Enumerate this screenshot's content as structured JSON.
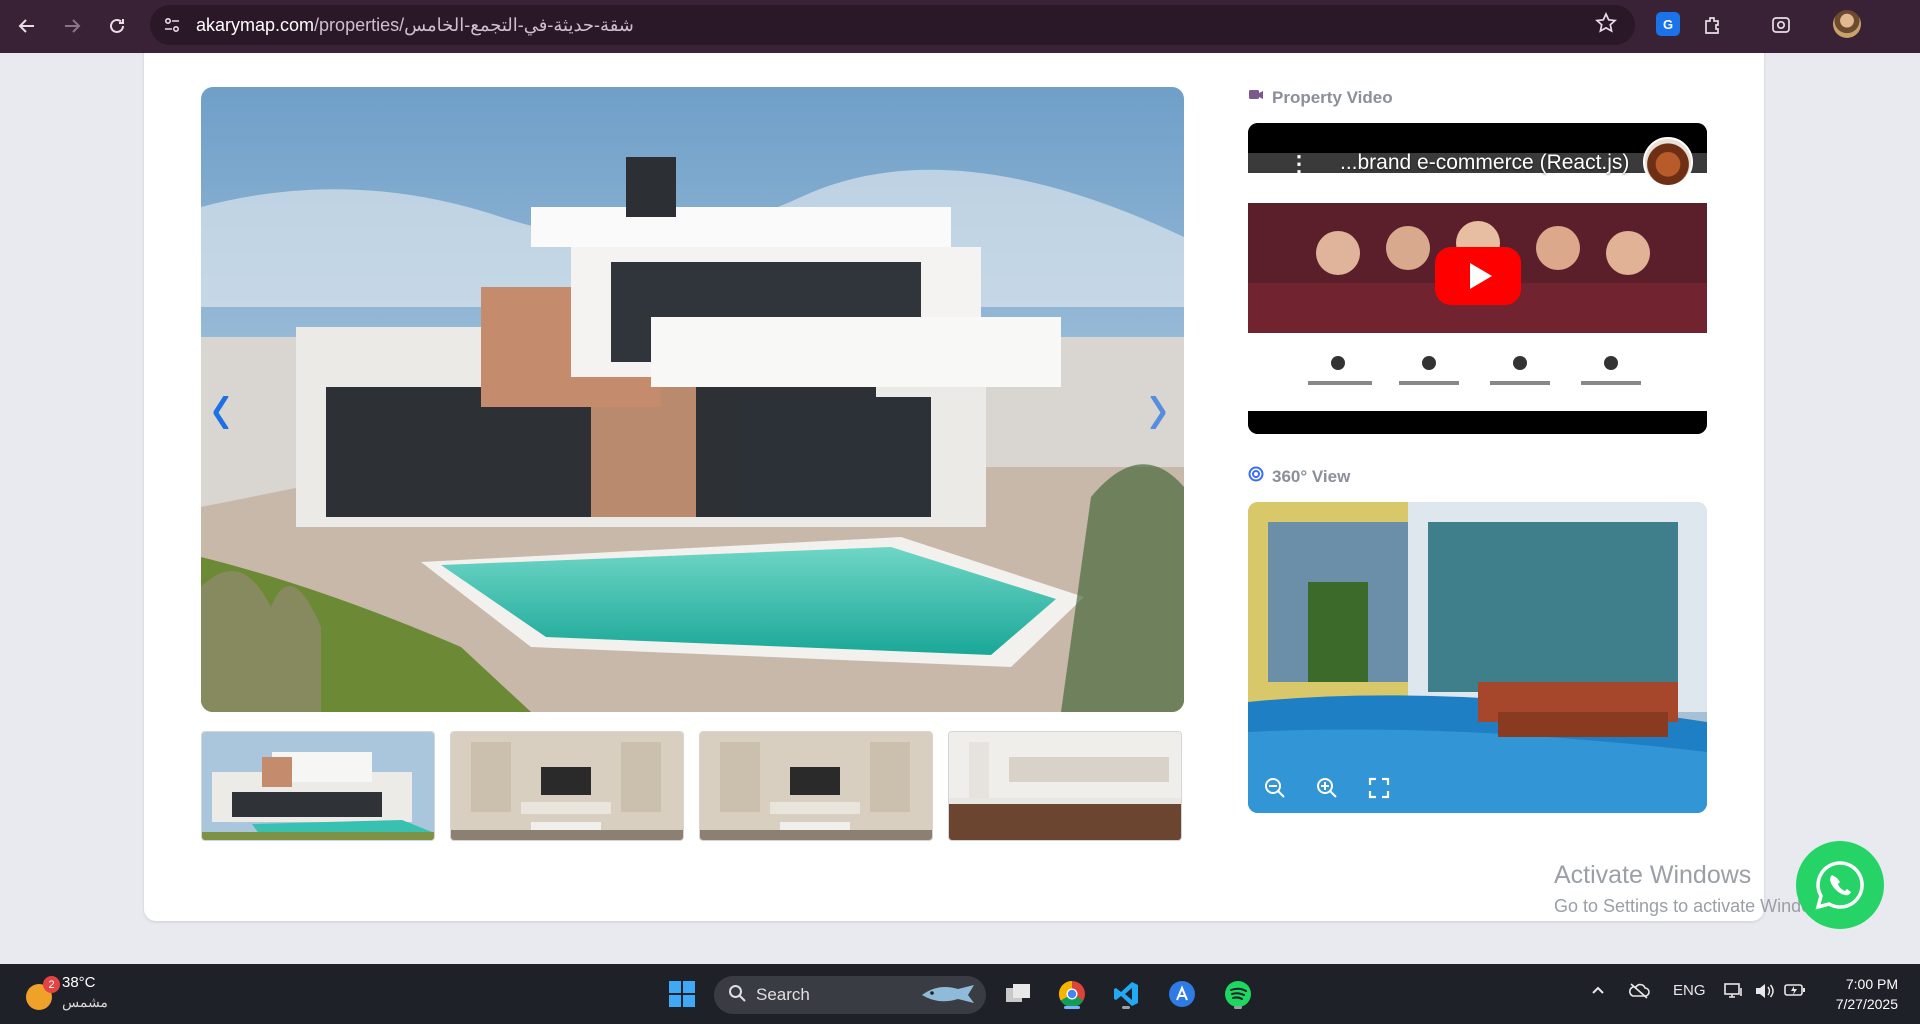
{
  "browser": {
    "url_host": "akarymap.com",
    "url_path": "/properties/شقة-حديثة-في-التجمع-الخامس",
    "icons": [
      "back-icon",
      "forward-icon",
      "reload-icon",
      "site-settings-icon",
      "bookmark-star-icon",
      "translate-icon",
      "extensions-icon",
      "lens-icon"
    ]
  },
  "gallery": {
    "thumbnails": [
      "exterior",
      "living-room",
      "living-room",
      "kitchen"
    ]
  },
  "video": {
    "section_title": "Property Video",
    "video_title": "...brand e-commerce (React.js)"
  },
  "pano": {
    "section_title": "360° View"
  },
  "windows_watermark": {
    "line1": "Activate Windows",
    "line2": "Go to Settings to activate Windows."
  },
  "taskbar": {
    "weather_badge": "2",
    "temperature": "38°C",
    "condition": "مشمس",
    "search_label": "Search",
    "language": "ENG",
    "time": "7:00 PM",
    "date": "7/27/2025"
  },
  "colors": {
    "browser_bg": "#3a2236",
    "accent_blue": "#1f6fe5",
    "whatsapp_green": "#25d366",
    "youtube_red": "#ff0000"
  }
}
